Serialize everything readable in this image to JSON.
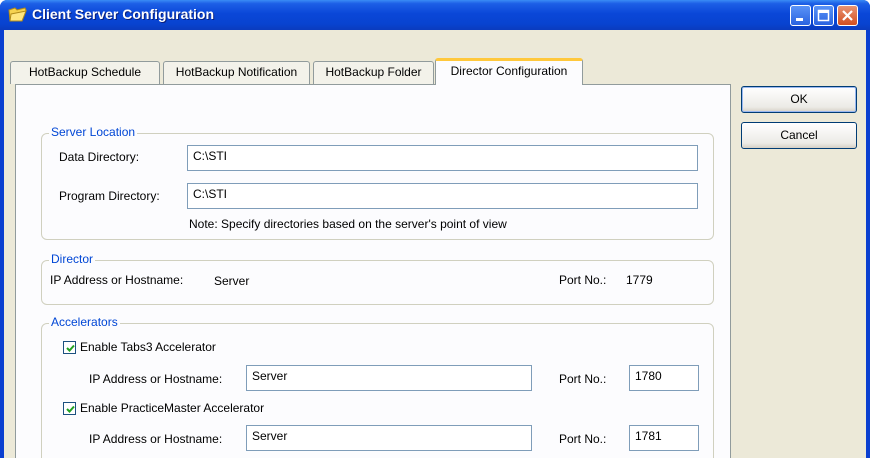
{
  "window": {
    "title": "Client Server Configuration"
  },
  "tabs": [
    {
      "label": "HotBackup Schedule"
    },
    {
      "label": "HotBackup Notification"
    },
    {
      "label": "HotBackup Folder"
    },
    {
      "label": "Director Configuration"
    }
  ],
  "server_location": {
    "legend": "Server Location",
    "data_dir_label": "Data Directory:",
    "data_dir_value": "C:\\STI",
    "program_dir_label": "Program Directory:",
    "program_dir_value": "C:\\STI",
    "note": "Note:  Specify directories based on the server's point of view"
  },
  "director": {
    "legend": "Director",
    "ip_label": "IP Address or Hostname:",
    "ip_value": "Server",
    "port_label": "Port No.:",
    "port_value": "1779"
  },
  "accelerators": {
    "legend": "Accelerators",
    "tabs3_label": "Enable Tabs3 Accelerator",
    "tabs3_checked": true,
    "tabs3_ip_label": "IP Address or Hostname:",
    "tabs3_ip_value": "Server",
    "tabs3_port_label": "Port No.:",
    "tabs3_port_value": "1780",
    "pm_label": "Enable PracticeMaster Accelerator",
    "pm_checked": true,
    "pm_ip_label": "IP Address or Hostname:",
    "pm_ip_value": "Server",
    "pm_port_label": "Port No.:",
    "pm_port_value": "1781"
  },
  "buttons": {
    "ok": "OK",
    "cancel": "Cancel"
  },
  "colors": {
    "title_bar": "#0a47d8",
    "dialog_bg": "#ece9d8",
    "legend_text": "#0046d5",
    "active_tab_accent": "#ffc83c"
  }
}
